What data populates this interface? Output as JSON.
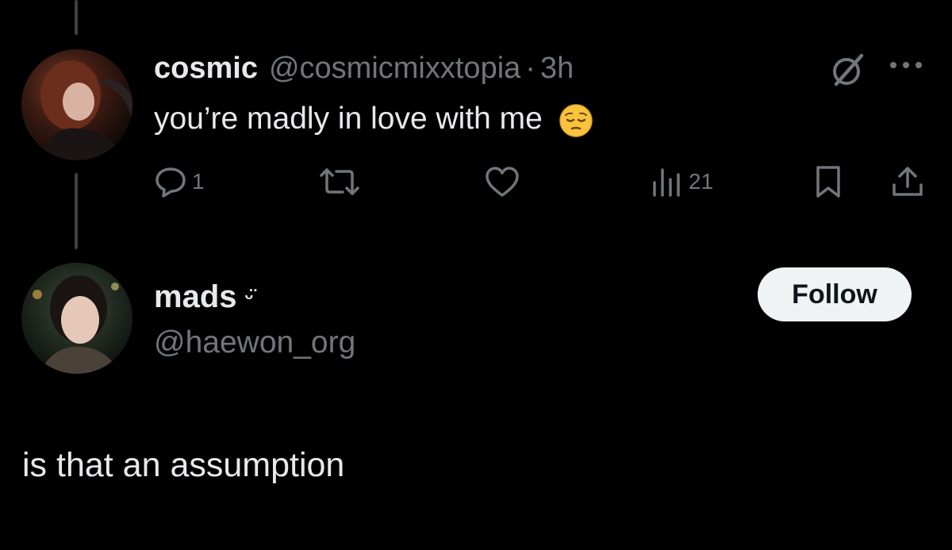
{
  "tweet": {
    "display_name": "cosmic",
    "handle": "@cosmicmixxtopia",
    "separator": "·",
    "time": "3h",
    "text": "you’re madly in love with me",
    "emoji": "pensive-face-emoji",
    "actions": {
      "replies": "1",
      "retweets": "",
      "likes": "",
      "views": "21"
    }
  },
  "profile": {
    "display_name": "mads",
    "name_suffix": "ᵕ̈",
    "handle": "@haewon_org",
    "follow_label": "Follow"
  },
  "reply": {
    "text": "is that an assumption"
  },
  "colors": {
    "background": "#000000",
    "primary_text": "#e7e9ea",
    "secondary_text": "#71767b",
    "thread_line": "#3e4144",
    "button_bg": "#eff3f4"
  }
}
